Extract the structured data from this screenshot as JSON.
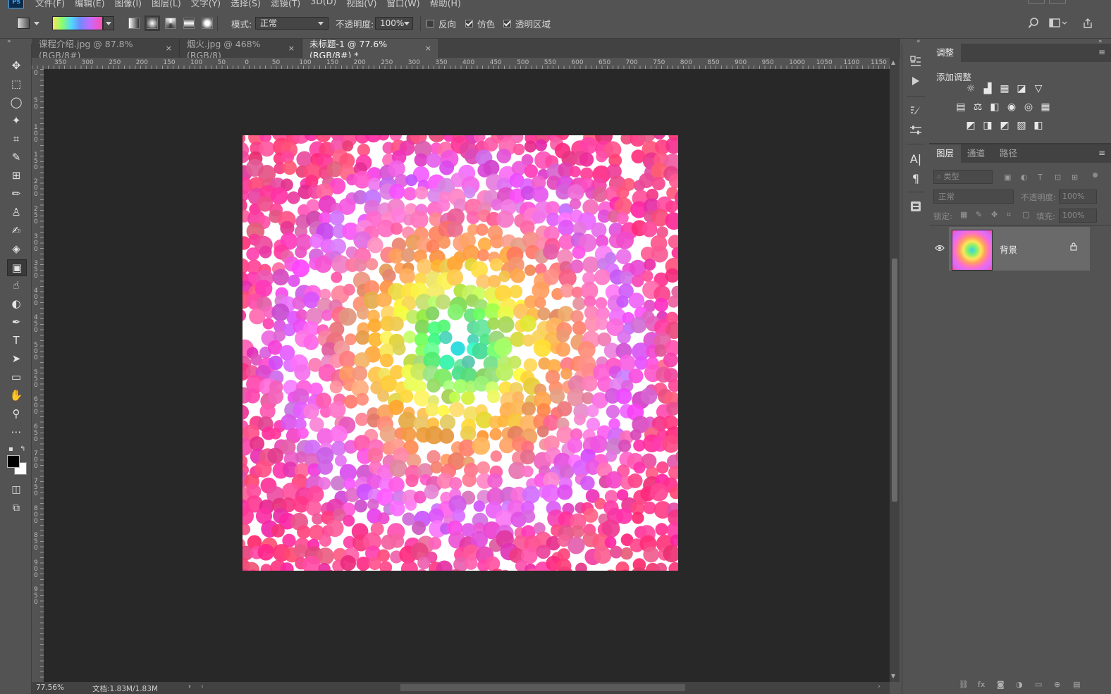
{
  "app": {
    "logo": "Ps"
  },
  "menu": [
    "文件(F)",
    "编辑(E)",
    "图像(I)",
    "图层(L)",
    "文字(Y)",
    "选择(S)",
    "滤镜(T)",
    "3D(D)",
    "视图(V)",
    "窗口(W)",
    "帮助(H)"
  ],
  "options": {
    "mode_label": "模式:",
    "mode_value": "正常",
    "opacity_label": "不透明度:",
    "opacity_value": "100%",
    "reverse_label": "反向",
    "dither_label": "仿色",
    "transparency_label": "透明区域",
    "reverse_checked": false,
    "dither_checked": true,
    "transparency_checked": true
  },
  "tabs": [
    {
      "label": "课程介绍.jpg @ 87.8%(RGB/8#)",
      "close": "×"
    },
    {
      "label": "烟火.jpg @ 468%(RGB/8)",
      "close": "×"
    },
    {
      "label": "未标题-1 @ 77.6%(RGB/8#) *",
      "close": "×"
    }
  ],
  "ruler": {
    "h": [
      "350",
      "300",
      "250",
      "200",
      "150",
      "100",
      "50",
      "0",
      "50",
      "100",
      "150",
      "200",
      "250",
      "300",
      "350",
      "400",
      "450",
      "500",
      "550",
      "600",
      "650",
      "700",
      "750",
      "800",
      "850",
      "900",
      "950",
      "1000",
      "1050",
      "1100",
      "1150"
    ],
    "v": [
      "0",
      "5\n0",
      "1\n0\n0",
      "1\n5\n0",
      "2\n0\n0",
      "2\n5\n0",
      "3\n0\n0",
      "3\n5\n0",
      "4\n0\n0",
      "4\n5\n0",
      "5\n0\n0",
      "5\n5\n0",
      "6\n0\n0",
      "6\n5\n0",
      "7\n0\n0",
      "7\n5\n0",
      "8\n0\n0",
      "8\n5\n0",
      "9\n0\n0",
      "9\n5\n0"
    ]
  },
  "status": {
    "zoom": "77.56%",
    "doc": "文档:1.83M/1.83M"
  },
  "adjustments": {
    "tab": "调整",
    "add_label": "添加调整"
  },
  "layers": {
    "tabs": [
      "图层",
      "通道",
      "路径"
    ],
    "filter_placeholder": "类型",
    "blend_mode": "正常",
    "opacity_label": "不透明度:",
    "opacity_value": "100%",
    "lock_label": "锁定:",
    "fill_label": "填充:",
    "fill_value": "100%",
    "items": [
      {
        "name": "背景",
        "visible": true,
        "locked": true
      }
    ]
  },
  "colors": {
    "accent": "#31a8ff",
    "canvas_bg": "#282828",
    "panel_bg": "#535353"
  }
}
